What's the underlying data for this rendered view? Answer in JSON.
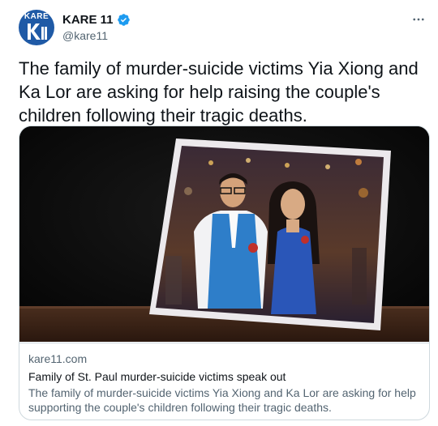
{
  "account": {
    "avatar_label": "KARE",
    "display_name": "KARE 11",
    "handle": "@kare11",
    "verified": true,
    "brand_color": "#1f5aa6"
  },
  "icons": {
    "verified": "verified-badge-icon",
    "more": "more-options-icon"
  },
  "tweet": {
    "text": "The family of murder-suicide victims Yia Xiong and Ka Lor are asking for help raising the couple's children following their tragic deaths."
  },
  "card": {
    "domain": "kare11.com",
    "title": "Family of St. Paul murder-suicide victims speak out",
    "description": "The family of murder-suicide victims Yia Xiong and Ka Lor are asking for help supporting the couple's children following their tragic deaths."
  },
  "colors": {
    "text": "#0f1419",
    "secondary": "#536471",
    "border": "#cfd9de",
    "verified_blue": "#1d9bf0"
  }
}
